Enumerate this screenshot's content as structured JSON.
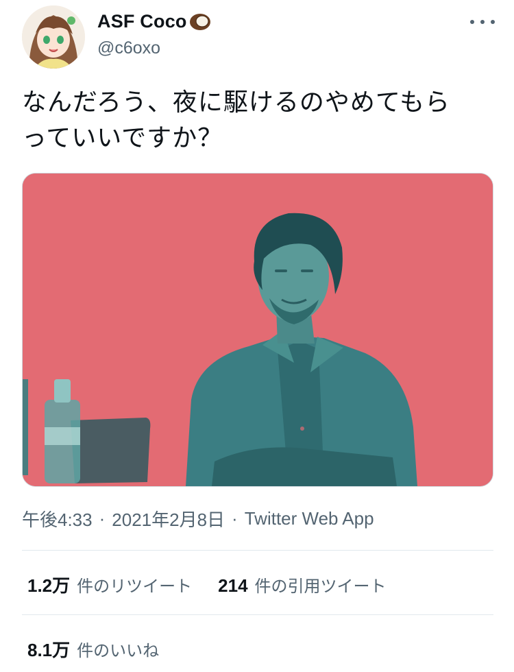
{
  "tweet": {
    "author": {
      "display_name": "ASF Coco",
      "handle": "@c6oxo",
      "name_emoji_icon": "coconut-icon"
    },
    "text_line_1": "なんだろう、夜に駆けるのやめてもら",
    "text_line_2": "っていいですか？",
    "timestamp": {
      "time": "午後4:33",
      "separator": "·",
      "date": "2021年2月8日",
      "source": "Twitter Web App"
    },
    "stats": {
      "retweets": {
        "count": "1.2万",
        "label": "件のリツイート"
      },
      "quotes": {
        "count": "214",
        "label": "件の引用ツイート"
      },
      "likes": {
        "count": "8.1万",
        "label": "件のいいね"
      }
    }
  },
  "colors": {
    "photo_background": "#e36b73",
    "photo_foreground": "#3e8c8c",
    "secondary_text": "#536471",
    "divider": "#e1e8ed"
  }
}
